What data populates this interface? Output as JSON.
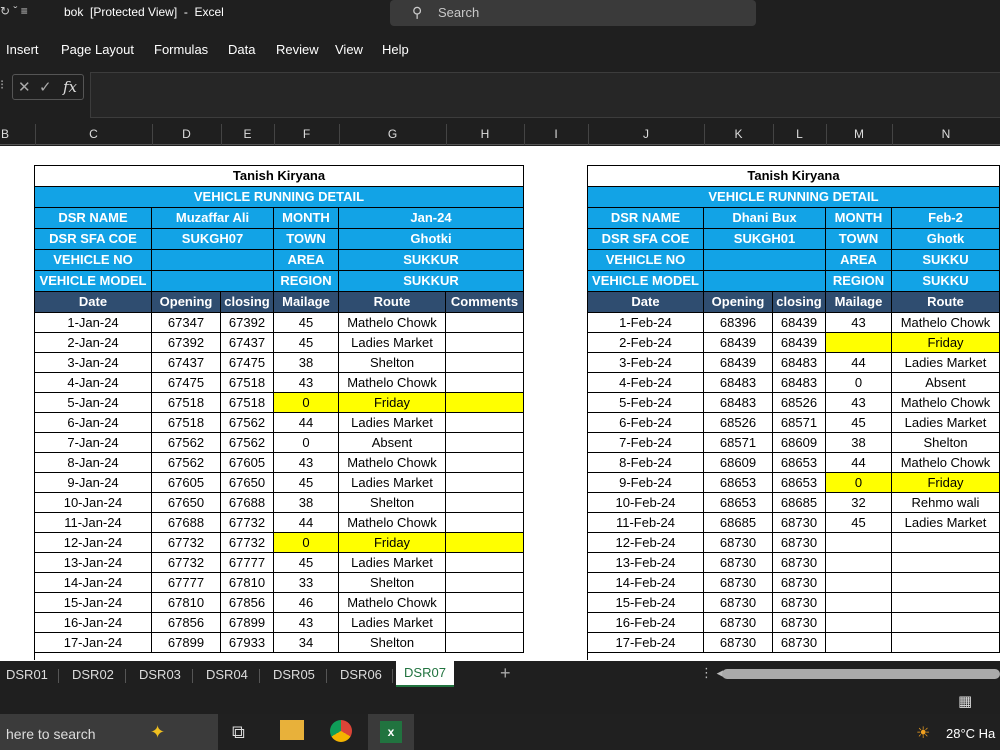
{
  "window": {
    "qat": "↻ ˇ   ≡",
    "title": "bok  [Protected View]  -  Excel",
    "search_placeholder": "Search"
  },
  "menu": [
    "Insert",
    "Page Layout",
    "Formulas",
    "Data",
    "Review",
    "View",
    "Help"
  ],
  "formula_bar": {
    "fx": "fx",
    "value": ""
  },
  "columns": [
    "B",
    "C",
    "D",
    "E",
    "F",
    "G",
    "H",
    "I",
    "J",
    "K",
    "L",
    "M",
    "N"
  ],
  "left_block": {
    "title": "Tanish Kiryana",
    "subtitle": "VEHICLE RUNNING DETAIL",
    "dsr_name_label": "DSR NAME",
    "dsr_name": "Muzaffar Ali",
    "month_label": "MONTH",
    "month": "Jan-24",
    "dsr_code_label": "DSR SFA COE",
    "dsr_code": "SUKGH07",
    "town_label": "TOWN",
    "town": "Ghotki",
    "vehicle_no_label": "VEHICLE NO",
    "vehicle_no": "",
    "area_label": "AREA",
    "area": "SUKKUR",
    "vehicle_model_label": "VEHICLE MODEL",
    "vehicle_model": "",
    "region_label": "REGION",
    "region": "SUKKUR",
    "headers": [
      "Date",
      "Opening",
      "closing",
      "Mailage",
      "Route",
      "Comments"
    ],
    "rows": [
      [
        "1-Jan-24",
        "67347",
        "67392",
        "45",
        "Mathelo Chowk",
        ""
      ],
      [
        "2-Jan-24",
        "67392",
        "67437",
        "45",
        "Ladies Market",
        ""
      ],
      [
        "3-Jan-24",
        "67437",
        "67475",
        "38",
        "Shelton",
        ""
      ],
      [
        "4-Jan-24",
        "67475",
        "67518",
        "43",
        "Mathelo Chowk",
        ""
      ],
      [
        "5-Jan-24",
        "67518",
        "67518",
        "0",
        "Friday",
        ""
      ],
      [
        "6-Jan-24",
        "67518",
        "67562",
        "44",
        "Ladies Market",
        ""
      ],
      [
        "7-Jan-24",
        "67562",
        "67562",
        "0",
        "Absent",
        ""
      ],
      [
        "8-Jan-24",
        "67562",
        "67605",
        "43",
        "Mathelo Chowk",
        ""
      ],
      [
        "9-Jan-24",
        "67605",
        "67650",
        "45",
        "Ladies Market",
        ""
      ],
      [
        "10-Jan-24",
        "67650",
        "67688",
        "38",
        "Shelton",
        ""
      ],
      [
        "11-Jan-24",
        "67688",
        "67732",
        "44",
        "Mathelo Chowk",
        ""
      ],
      [
        "12-Jan-24",
        "67732",
        "67732",
        "0",
        "Friday",
        ""
      ],
      [
        "13-Jan-24",
        "67732",
        "67777",
        "45",
        "Ladies Market",
        ""
      ],
      [
        "14-Jan-24",
        "67777",
        "67810",
        "33",
        "Shelton",
        ""
      ],
      [
        "15-Jan-24",
        "67810",
        "67856",
        "46",
        "Mathelo Chowk",
        ""
      ],
      [
        "16-Jan-24",
        "67856",
        "67899",
        "43",
        "Ladies Market",
        ""
      ],
      [
        "17-Jan-24",
        "67899",
        "67933",
        "34",
        "Shelton",
        ""
      ]
    ],
    "highlight_rows": [
      4,
      11
    ]
  },
  "right_block": {
    "title": "Tanish Kiryana",
    "subtitle": "VEHICLE RUNNING DETAIL",
    "dsr_name_label": "DSR NAME",
    "dsr_name": "Dhani Bux",
    "month_label": "MONTH",
    "month": "Feb-2",
    "dsr_code_label": "DSR SFA COE",
    "dsr_code": "SUKGH01",
    "town_label": "TOWN",
    "town": "Ghotk",
    "vehicle_no_label": "VEHICLE NO",
    "vehicle_no": "",
    "area_label": "AREA",
    "area": "SUKKU",
    "vehicle_model_label": "VEHICLE MODEL",
    "vehicle_model": "",
    "region_label": "REGION",
    "region": "SUKKU",
    "headers": [
      "Date",
      "Opening",
      "closing",
      "Mailage",
      "Route"
    ],
    "rows": [
      [
        "1-Feb-24",
        "68396",
        "68439",
        "43",
        "Mathelo Chowk"
      ],
      [
        "2-Feb-24",
        "68439",
        "68439",
        "",
        "Friday"
      ],
      [
        "3-Feb-24",
        "68439",
        "68483",
        "44",
        "Ladies Market"
      ],
      [
        "4-Feb-24",
        "68483",
        "68483",
        "0",
        "Absent"
      ],
      [
        "5-Feb-24",
        "68483",
        "68526",
        "43",
        "Mathelo Chowk"
      ],
      [
        "6-Feb-24",
        "68526",
        "68571",
        "45",
        "Ladies Market"
      ],
      [
        "7-Feb-24",
        "68571",
        "68609",
        "38",
        "Shelton"
      ],
      [
        "8-Feb-24",
        "68609",
        "68653",
        "44",
        "Mathelo Chowk"
      ],
      [
        "9-Feb-24",
        "68653",
        "68653",
        "0",
        "Friday"
      ],
      [
        "10-Feb-24",
        "68653",
        "68685",
        "32",
        "Rehmo wali"
      ],
      [
        "11-Feb-24",
        "68685",
        "68730",
        "45",
        "Ladies Market"
      ],
      [
        "12-Feb-24",
        "68730",
        "68730",
        "",
        ""
      ],
      [
        "13-Feb-24",
        "68730",
        "68730",
        "",
        ""
      ],
      [
        "14-Feb-24",
        "68730",
        "68730",
        "",
        ""
      ],
      [
        "15-Feb-24",
        "68730",
        "68730",
        "",
        ""
      ],
      [
        "16-Feb-24",
        "68730",
        "68730",
        "",
        ""
      ],
      [
        "17-Feb-24",
        "68730",
        "68730",
        "",
        ""
      ]
    ],
    "highlight_rows": [
      1,
      8
    ]
  },
  "sheet_tabs": [
    "DSR01",
    "DSR02",
    "DSR03",
    "DSR04",
    "DSR05",
    "DSR06",
    "DSR07"
  ],
  "active_tab": "DSR07",
  "add_sheet": "+",
  "taskbar": {
    "search": "here to search",
    "temp": "28°C  Ha"
  },
  "colors": {
    "header_blue": "#12a3e6",
    "table_header": "#2f4d70",
    "highlight": "#ffff00",
    "excel_green": "#21733f"
  }
}
